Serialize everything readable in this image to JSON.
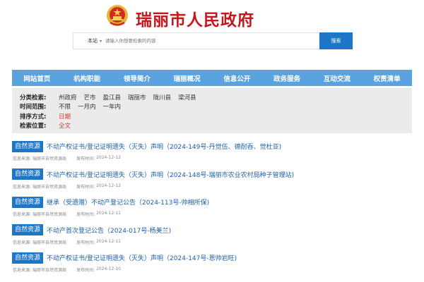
{
  "header": {
    "title": "瑞丽市人民政府",
    "emblem_icon": "national-emblem-icon"
  },
  "search": {
    "scope": "本站",
    "placeholder": "请输入你想要检索的内容",
    "button": "搜索"
  },
  "nav": [
    {
      "label": "网站首页"
    },
    {
      "label": "机构职能"
    },
    {
      "label": "领导简介"
    },
    {
      "label": "瑞丽概况"
    },
    {
      "label": "信息公开"
    },
    {
      "label": "政务服务"
    },
    {
      "label": "互动交流"
    },
    {
      "label": "权责清单"
    }
  ],
  "filters": {
    "category": {
      "label": "分类检索:",
      "options": [
        "州政府",
        "芒市",
        "盈江县",
        "瑞丽市",
        "陇川县",
        "梁河县"
      ]
    },
    "time": {
      "label": "时间范围:",
      "options": [
        "不限",
        "一月内",
        "一年内"
      ]
    },
    "sort": {
      "label": "排序方式:",
      "value": "日期"
    },
    "position": {
      "label": "检索位置:",
      "value": "全文"
    }
  },
  "results": [
    {
      "tag": "自然资源",
      "title": "不动产权证书/登记证明遗失（灭失）声明（2024-149号-丹觉伍、德耐吞、觉杜亚)",
      "source_label": "信息来源:",
      "source": "瑞丽市自然资源局",
      "date_label": "发布时间:",
      "date": "2024-12-12"
    },
    {
      "tag": "自然资源",
      "title": "不动产权证书/登记证明遗失（灭失）声明（2024-148号-瑞丽市农业农村局种子管理站)",
      "source_label": "信息来源:",
      "source": "瑞丽市自然资源局",
      "date_label": "发布时间:",
      "date": "2024-12-12"
    },
    {
      "tag": "自然资源",
      "title": "继承（受遗赠）不动产登记公告（2024-113号-帅相所保)",
      "source_label": "信息来源:",
      "source": "瑞丽市自然资源局",
      "date_label": "发布时间:",
      "date": "2024-12-11"
    },
    {
      "tag": "自然资源",
      "title": "不动产首次登记公告（2024-017号-杨美兰)",
      "source_label": "信息来源:",
      "source": "瑞丽市自然资源局",
      "date_label": "发布时间:",
      "date": "2024-12-11"
    },
    {
      "tag": "自然资源",
      "title": "不动产权证书/登记证明遗失（灭失）声明（2024-147号-恩帅岩旺)",
      "source_label": "信息来源:",
      "source": "瑞丽市自然资源局",
      "date_label": "发布时间:",
      "date": "2024-12-10"
    }
  ],
  "colors": {
    "brand_red": "#c8161d",
    "nav_blue": "#5ba3e0",
    "tag_blue": "#1e76c8",
    "active_red": "#e03232"
  }
}
